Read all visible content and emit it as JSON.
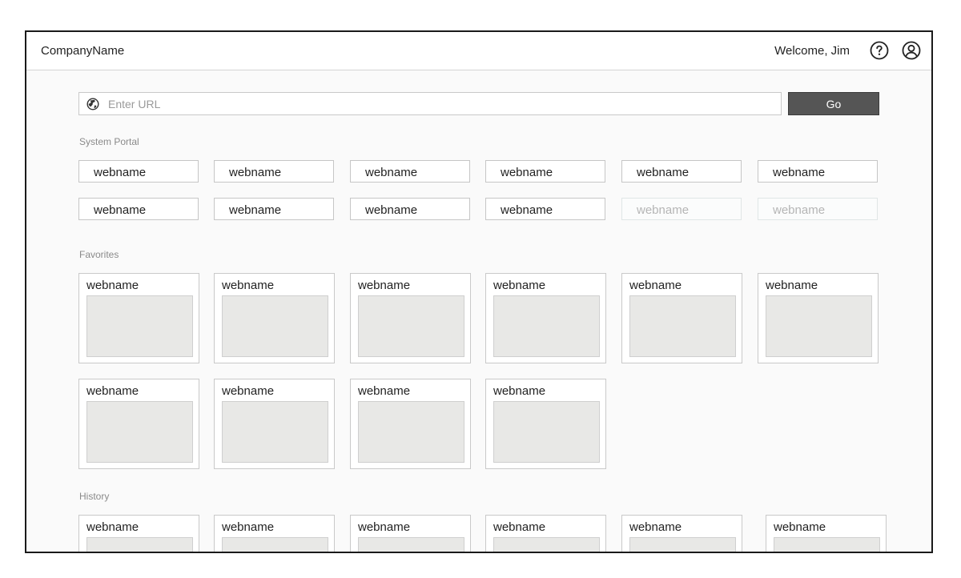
{
  "header": {
    "company": "CompanyName",
    "welcome": "Welcome, Jim"
  },
  "search": {
    "placeholder": "Enter URL",
    "value": "",
    "go_label": "Go",
    "icon": "globe-icon"
  },
  "system_portal": {
    "label": "System Portal",
    "items": [
      {
        "label": "webname",
        "enabled": true
      },
      {
        "label": "webname",
        "enabled": true
      },
      {
        "label": "webname",
        "enabled": true
      },
      {
        "label": "webname",
        "enabled": true
      },
      {
        "label": "webname",
        "enabled": true
      },
      {
        "label": "webname",
        "enabled": true
      },
      {
        "label": "webname",
        "enabled": true
      },
      {
        "label": "webname",
        "enabled": true
      },
      {
        "label": "webname",
        "enabled": true
      },
      {
        "label": "webname",
        "enabled": true
      },
      {
        "label": "webname",
        "enabled": false
      },
      {
        "label": "webname",
        "enabled": false
      }
    ]
  },
  "favorites": {
    "label": "Favorites",
    "items": [
      {
        "label": "webname"
      },
      {
        "label": "webname"
      },
      {
        "label": "webname"
      },
      {
        "label": "webname"
      },
      {
        "label": "webname"
      },
      {
        "label": "webname"
      },
      {
        "label": "webname"
      },
      {
        "label": "webname"
      },
      {
        "label": "webname"
      },
      {
        "label": "webname"
      }
    ]
  },
  "history": {
    "label": "History",
    "items": [
      {
        "label": "webname"
      },
      {
        "label": "webname"
      },
      {
        "label": "webname"
      },
      {
        "label": "webname"
      },
      {
        "label": "webname"
      },
      {
        "label": "webname"
      }
    ]
  },
  "colors": {
    "frame_border": "#1a1a1a",
    "go_button": "#555555",
    "thumb_fill": "#e8e8e6",
    "disabled_text": "#b5b5b5"
  }
}
